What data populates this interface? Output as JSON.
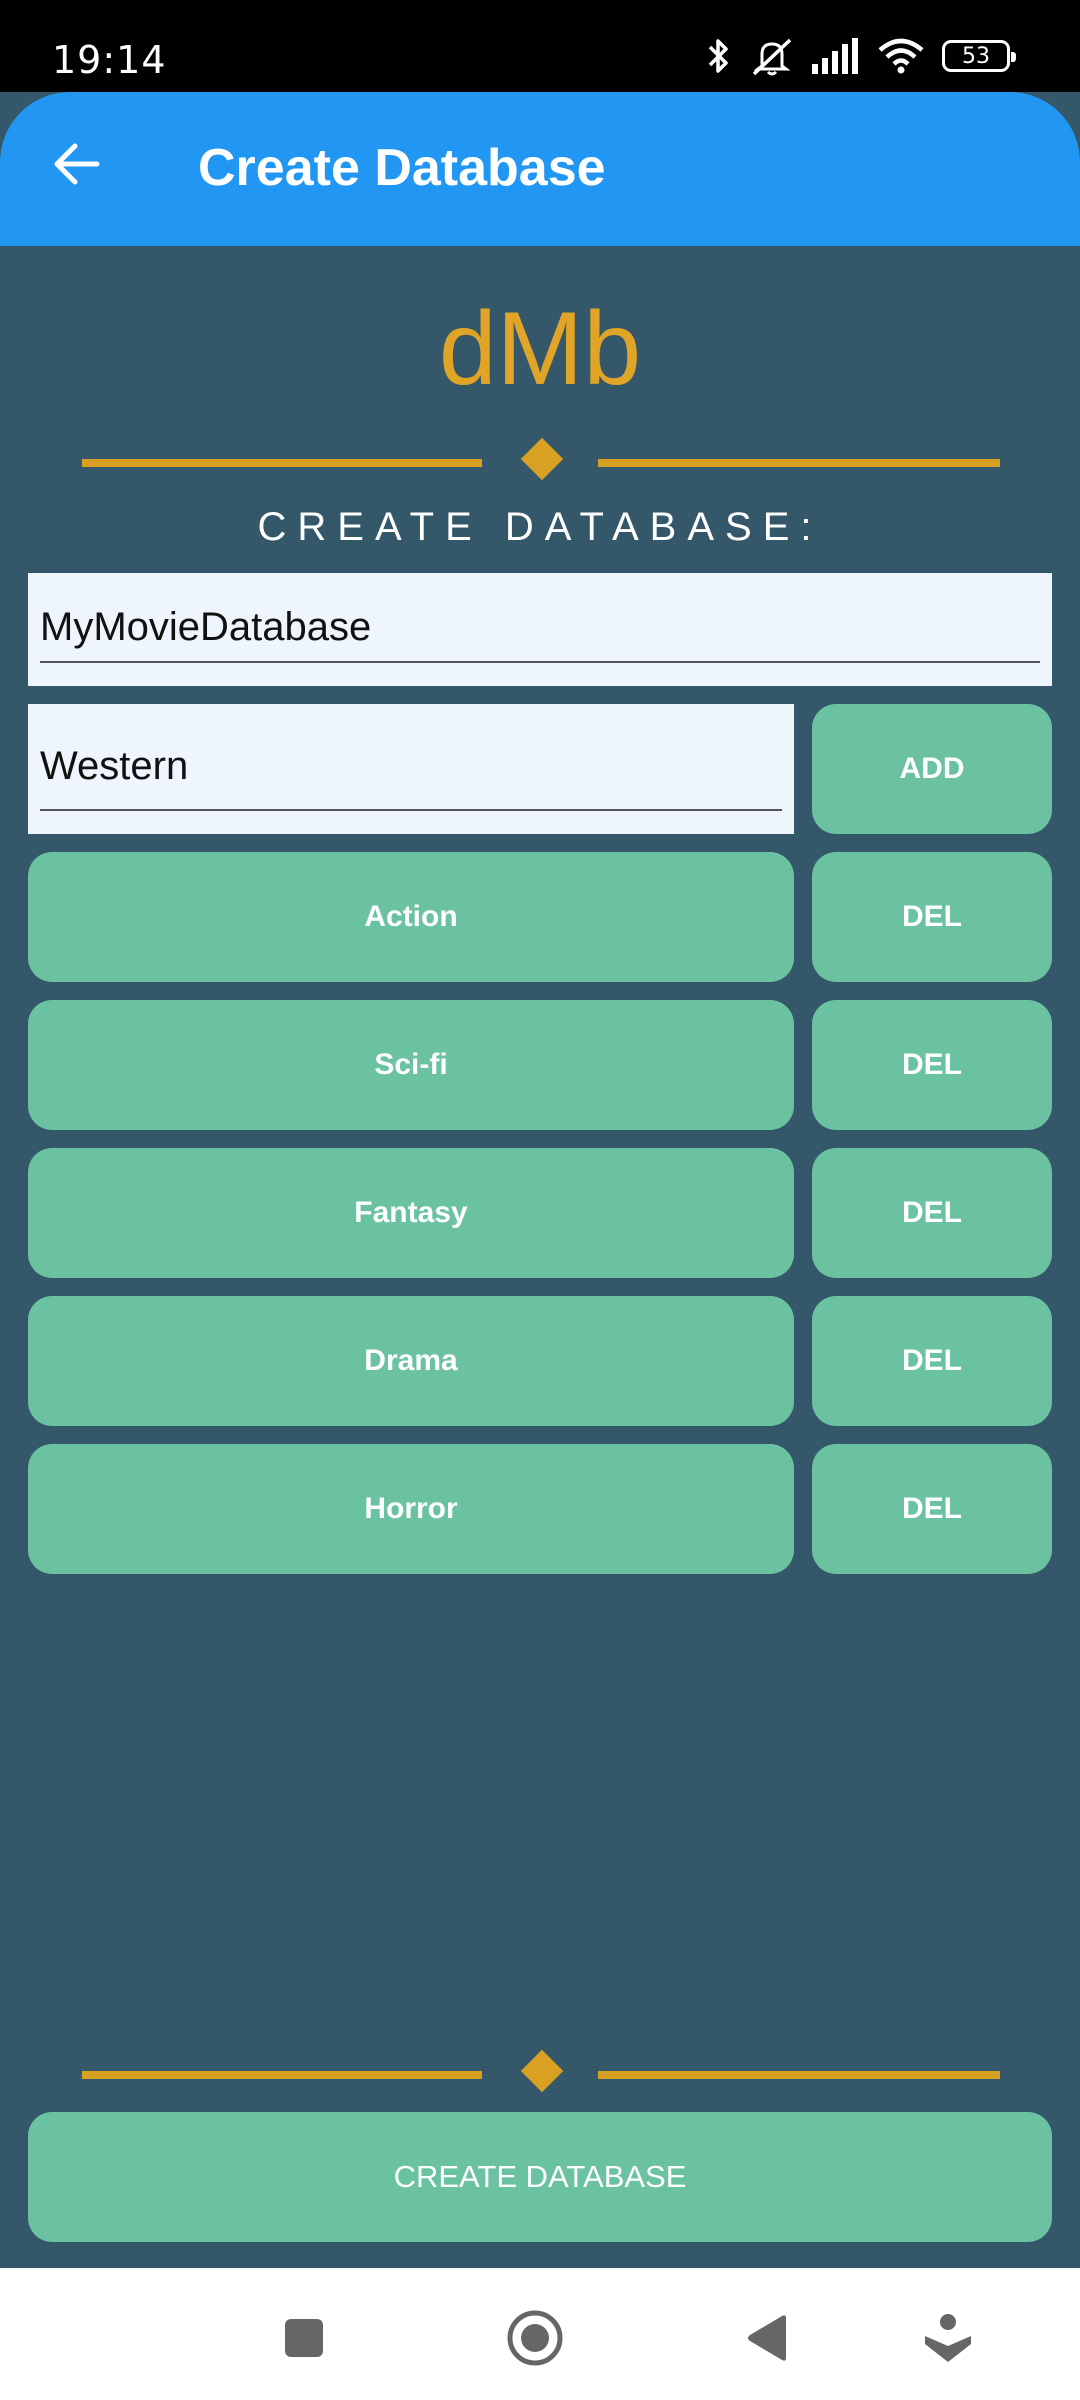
{
  "status_bar": {
    "time": "19:14",
    "battery": "53",
    "icons": [
      "bluetooth-icon",
      "mute-icon",
      "signal-icon",
      "wifi-icon",
      "battery-icon"
    ]
  },
  "app_bar": {
    "title": "Create Database",
    "back_icon": "arrow-left-icon",
    "color": "#2196F3"
  },
  "logo": "dMb",
  "section_title": "CREATE DATABASE:",
  "database_name_input": {
    "value": "MyMovieDatabase"
  },
  "genre_input": {
    "value": "Western"
  },
  "add_button": "ADD",
  "genres": [
    {
      "label": "Action",
      "delete_label": "DEL"
    },
    {
      "label": "Sci-fi",
      "delete_label": "DEL"
    },
    {
      "label": "Fantasy",
      "delete_label": "DEL"
    },
    {
      "label": "Drama",
      "delete_label": "DEL"
    },
    {
      "label": "Horror",
      "delete_label": "DEL"
    }
  ],
  "create_button": "CREATE DATABASE",
  "nav_bar": {
    "icons": [
      "recents-square-icon",
      "home-circle-icon",
      "back-triangle-icon",
      "accessibility-icon"
    ]
  },
  "colors": {
    "background": "#345769",
    "accent_gold": "#E0A526",
    "button_green": "#6BC2A1",
    "input_background": "#EEF5FD"
  }
}
